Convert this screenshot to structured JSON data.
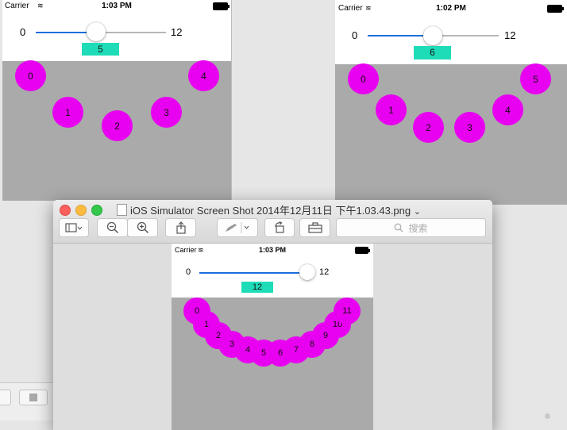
{
  "screens": [
    {
      "carrier": "Carrier",
      "time": "1:03 PM",
      "slider_min": "0",
      "slider_max": "12",
      "slider_fraction": 0.42,
      "value": "5",
      "ball_labels": [
        "0",
        "1",
        "2",
        "3",
        "4"
      ]
    },
    {
      "carrier": "Carrier",
      "time": "1:02 PM",
      "slider_min": "0",
      "slider_max": "12",
      "slider_fraction": 0.5,
      "value": "6",
      "ball_labels": [
        "0",
        "1",
        "2",
        "3",
        "4",
        "5"
      ]
    },
    {
      "carrier": "Carrier",
      "time": "1:03 PM",
      "slider_min": "0",
      "slider_max": "12",
      "slider_fraction": 1.0,
      "value": "12",
      "ball_labels": [
        "0",
        "1",
        "2",
        "3",
        "4",
        "5",
        "6",
        "7",
        "8",
        "9",
        "10",
        "11"
      ]
    }
  ],
  "preview_window": {
    "title": "iOS Simulator Screen Shot 2014年12月11日 下午1.03.43.png",
    "title_chevron": "⌄",
    "search_placeholder": "搜索",
    "toolbar_icons": [
      "sidebar-icon",
      "zoom-out-icon",
      "zoom-in-icon",
      "share-icon",
      "markup-pen-icon",
      "rotate-icon",
      "toolbox-icon"
    ],
    "traffic_light_colors": [
      "#fc605c",
      "#fdbc40",
      "#34c84a"
    ]
  },
  "colors": {
    "ball": "#e800f0",
    "value_box": "#1edcb8",
    "slider_fill": "#1c6edb",
    "gray_area": "#aaaaaa"
  }
}
